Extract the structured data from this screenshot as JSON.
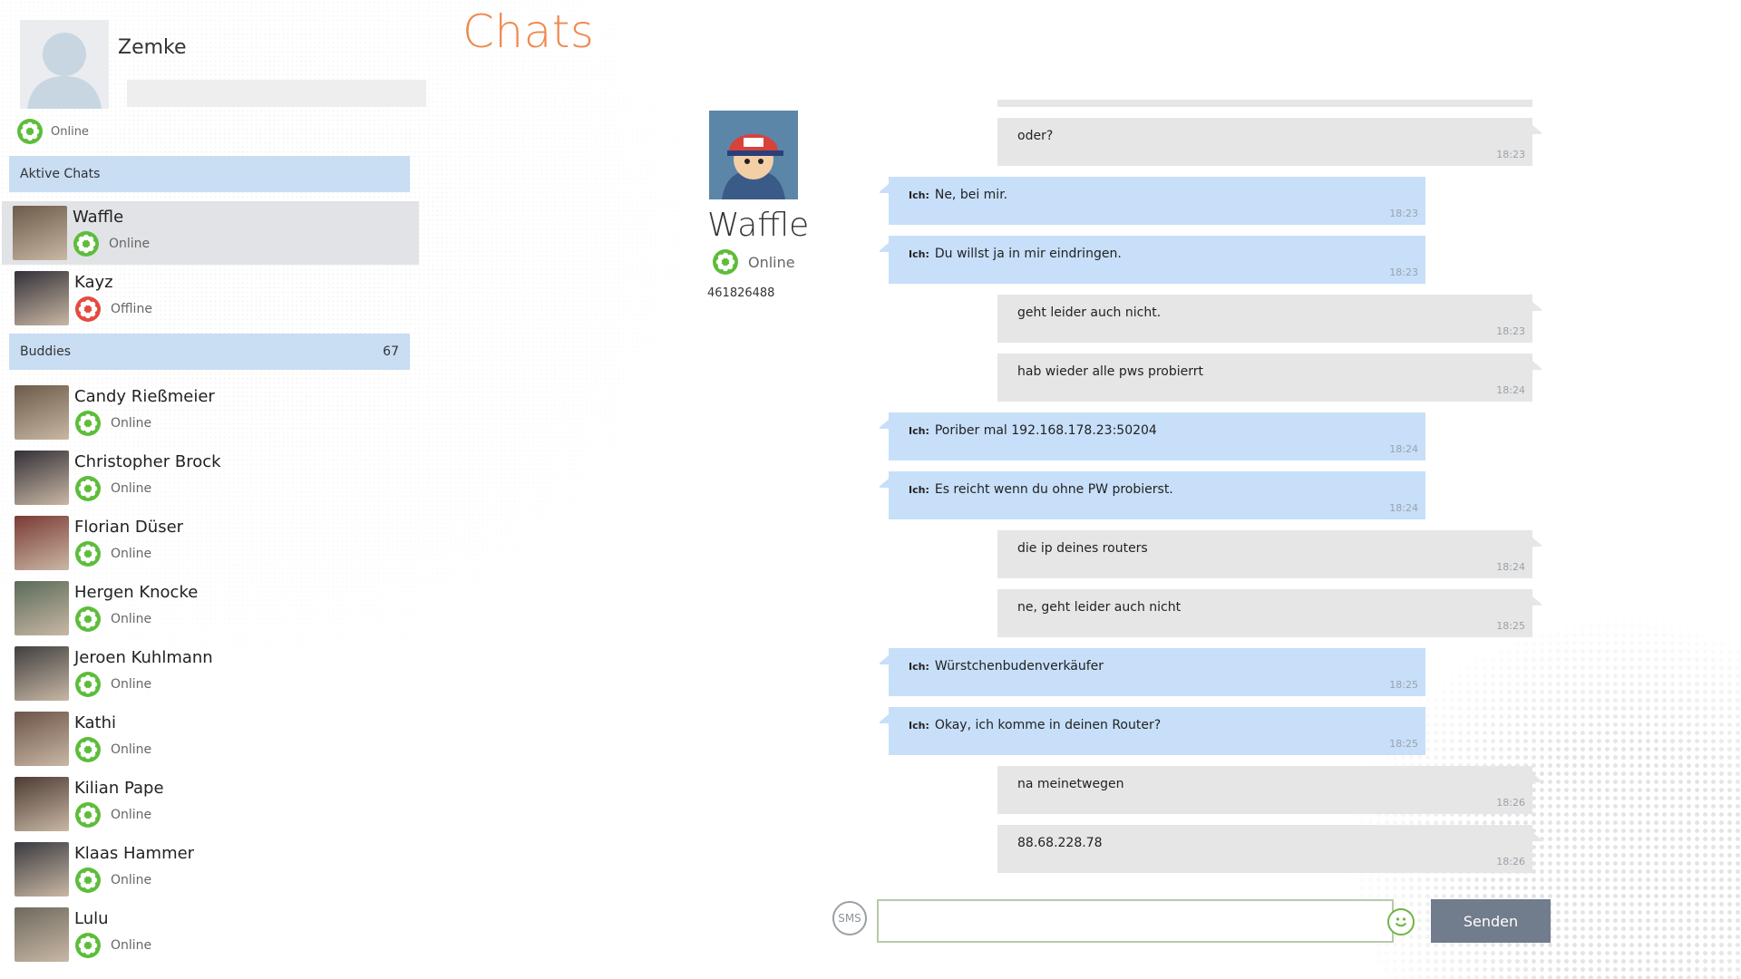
{
  "app": {
    "title": "Chats"
  },
  "profile": {
    "name": "Zemke",
    "status": "Online"
  },
  "sections": {
    "active_chats": "Aktive Chats",
    "buddies": "Buddies",
    "buddies_count": "67"
  },
  "active_chats": [
    {
      "name": "Waffle",
      "status": "Online",
      "status_color": "#5dbd3a"
    },
    {
      "name": "Kayz",
      "status": "Offline",
      "status_color": "#e34b3f"
    }
  ],
  "buddies": [
    {
      "name": "Candy Rießmeier",
      "status": "Online"
    },
    {
      "name": "Christopher Brock",
      "status": "Online"
    },
    {
      "name": "Florian Düser",
      "status": "Online"
    },
    {
      "name": "Hergen Knocke",
      "status": "Online"
    },
    {
      "name": "Jeroen Kuhlmann",
      "status": "Online"
    },
    {
      "name": "Kathi",
      "status": "Online"
    },
    {
      "name": "Kilian Pape",
      "status": "Online"
    },
    {
      "name": "Klaas Hammer",
      "status": "Online"
    },
    {
      "name": "Lulu",
      "status": "Online"
    }
  ],
  "buddy": {
    "name": "Waffle",
    "status": "Online",
    "number": "461826488"
  },
  "messages": [
    {
      "from": "other",
      "text": "",
      "time": "18:23"
    },
    {
      "from": "other",
      "text": "oder?",
      "time": "18:23"
    },
    {
      "from": "me",
      "prefix": "Ich:",
      "text": "Ne, bei mir.",
      "time": "18:23"
    },
    {
      "from": "me",
      "prefix": "Ich:",
      "text": "Du willst ja in mir eindringen.",
      "time": "18:23"
    },
    {
      "from": "other",
      "text": "geht leider auch nicht.",
      "time": "18:23"
    },
    {
      "from": "other",
      "text": "hab wieder alle pws probierrt",
      "time": "18:24"
    },
    {
      "from": "me",
      "prefix": "Ich:",
      "text": "Poriber mal 192.168.178.23:50204",
      "time": "18:24"
    },
    {
      "from": "me",
      "prefix": "Ich:",
      "text": "Es reicht wenn du ohne PW probierst.",
      "time": "18:24"
    },
    {
      "from": "other",
      "text": "die ip deines routers",
      "time": "18:24"
    },
    {
      "from": "other",
      "text": "ne, geht leider auch nicht",
      "time": "18:25"
    },
    {
      "from": "me",
      "prefix": "Ich:",
      "text": "Würstchenbudenverkäufer",
      "time": "18:25"
    },
    {
      "from": "me",
      "prefix": "Ich:",
      "text": "Okay, ich komme in deinen Router?",
      "time": "18:25"
    },
    {
      "from": "other",
      "text": "na meinetwegen",
      "time": "18:26"
    },
    {
      "from": "other",
      "text": "88.68.228.78",
      "time": "18:26"
    }
  ],
  "composer": {
    "sms_label": "SMS",
    "placeholder": "",
    "send_label": "Senden"
  },
  "colors": {
    "accent": "#ef8a50",
    "online": "#5dbd3a",
    "offline": "#e34b3f",
    "header_bg": "#c9ddf3",
    "me_bubble": "#c7dff9",
    "other_bubble": "#e6e6e6"
  }
}
